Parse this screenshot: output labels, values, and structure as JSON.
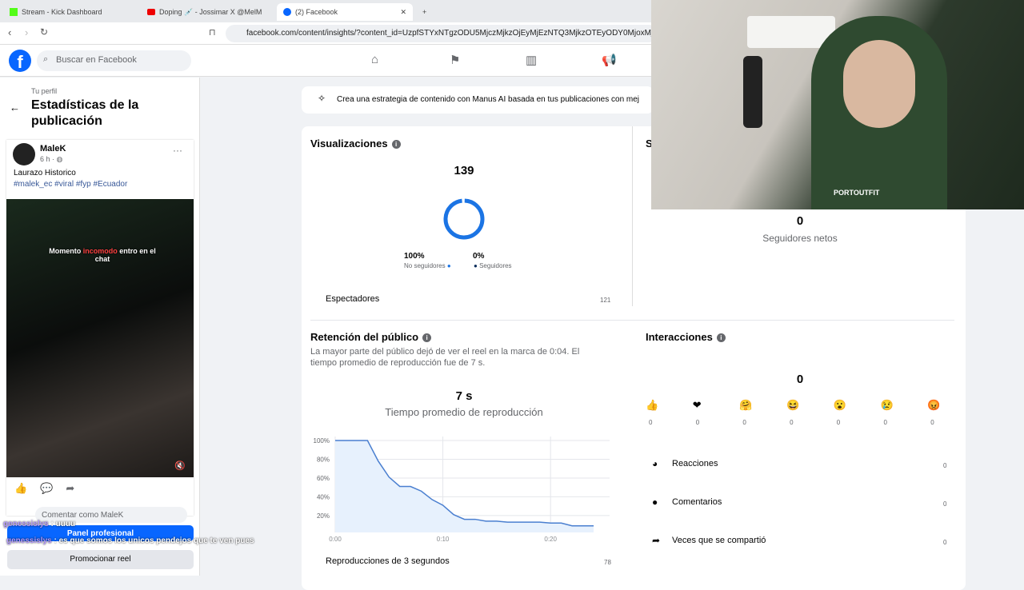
{
  "browser": {
    "tabs": [
      {
        "label": "Stream - Kick Dashboard"
      },
      {
        "label": "Doping 💉 - Jossimar X @MelM"
      },
      {
        "label": "(2) Facebook"
      }
    ],
    "url": "facebook.com/content/insights/?content_id=UzpfSTYxNTgzODU5MjczMjkzOjEyMjEzNTQ3MjkzOTEyODY0MjoxMjIxMz"
  },
  "fb": {
    "search_placeholder": "Buscar en Facebook",
    "logo": "f"
  },
  "left": {
    "breadcrumb": "Tu perfil",
    "title": "Estadísticas de la publicación",
    "post": {
      "author": "MaleK",
      "time": "6 h ·",
      "caption": "Laurazo Historico",
      "hashtags": "#malek_ec #viral #fyp #Ecuador",
      "overlay_a": "Momento ",
      "overlay_b": "incomodo",
      "overlay_c": " entro en el chat"
    },
    "comment_placeholder": "Comentar como MaleK",
    "panel_button": "Panel profesional",
    "promote_button": "Promocionar reel"
  },
  "banner": "Crea una estrategia de contenido con Manus AI basada en tus publicaciones con mej",
  "views": {
    "title": "Visualizaciones",
    "total": "139",
    "non_followers_pct": "100%",
    "non_followers_label": "No seguidores",
    "followers_pct": "0%",
    "followers_label": "Seguidores",
    "viewers_label": "Espectadores",
    "viewers_value": "121",
    "colors": {
      "non_followers": "#1b74e4",
      "followers": "#0a2d5c"
    }
  },
  "followers": {
    "title_partial": "S",
    "value": "0",
    "label": "Seguidores netos"
  },
  "retention": {
    "title": "Retención del público",
    "description": "La mayor parte del público dejó de ver el reel en la marca de 0:04. El tiempo promedio de reproducción fue de 7 s.",
    "avg": "7 s",
    "avg_label": "Tiempo promedio de reproducción",
    "plays_label": "Reproducciones de 3 segundos",
    "plays_value": "78"
  },
  "chart_data": {
    "type": "area",
    "x_unit": "seconds",
    "x": [
      0,
      3,
      4,
      5,
      6,
      7,
      8,
      9,
      10,
      11,
      12,
      13,
      14,
      15,
      16,
      19,
      20,
      21,
      22,
      24
    ],
    "values": [
      100,
      100,
      78,
      61,
      51,
      51,
      46,
      37,
      31,
      21,
      16,
      16,
      14,
      14,
      13,
      13,
      12,
      12,
      9,
      9
    ],
    "yticks": [
      "100%",
      "80%",
      "60%",
      "40%",
      "20%"
    ],
    "xticks": [
      "0:00",
      "0:10",
      "0:20"
    ],
    "ylim": [
      2,
      100
    ],
    "xlim": [
      0,
      24
    ],
    "grid": true,
    "color": "#4a7fd0"
  },
  "interactions": {
    "title": "Interacciones",
    "total": "0",
    "reactions": [
      {
        "icon": "like-icon",
        "emoji": "👍",
        "value": "0"
      },
      {
        "icon": "love-icon",
        "emoji": "❤",
        "value": "0"
      },
      {
        "icon": "care-icon",
        "emoji": "🤗",
        "value": "0"
      },
      {
        "icon": "haha-icon",
        "emoji": "😆",
        "value": "0"
      },
      {
        "icon": "wow-icon",
        "emoji": "😮",
        "value": "0"
      },
      {
        "icon": "sad-icon",
        "emoji": "😢",
        "value": "0"
      },
      {
        "icon": "angry-icon",
        "emoji": "😡",
        "value": "0"
      }
    ],
    "rows": [
      {
        "label": "Reacciones",
        "value": "0"
      },
      {
        "label": "Comentarios",
        "value": "0"
      },
      {
        "label": "Veces que se compartió",
        "value": "0"
      }
    ]
  },
  "stream_chat": [
    {
      "user": "genessislys",
      "msg": " : uuuu"
    },
    {
      "user": "genessislys",
      "msg": " : es que somos los unicos pendejos que te ven pues"
    }
  ],
  "webcam": {
    "hoodie_logo": "PORTOUTFIT"
  }
}
